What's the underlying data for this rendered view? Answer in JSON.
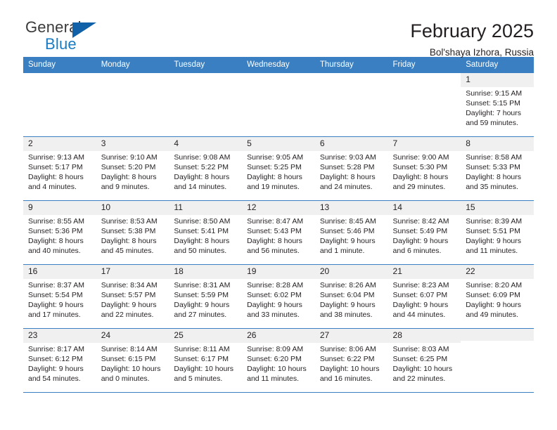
{
  "brand": {
    "name_top": "General",
    "name_bottom": "Blue",
    "triangle_icon": "triangle-icon",
    "color_primary": "#1161a8",
    "color_text": "#3b3b3b"
  },
  "header": {
    "title": "February 2025",
    "subtitle": "Bol'shaya Izhora, Russia"
  },
  "theme": {
    "header_blue": "#3a7fc1",
    "daynum_gray": "#f0f0f0",
    "text": "#231f20"
  },
  "calendar": {
    "weekdays": [
      "Sunday",
      "Monday",
      "Tuesday",
      "Wednesday",
      "Thursday",
      "Friday",
      "Saturday"
    ],
    "labels": {
      "sunrise": "Sunrise:",
      "sunset": "Sunset:",
      "daylight": "Daylight:"
    },
    "weeks": [
      [
        {
          "day": "",
          "blank": true
        },
        {
          "day": "",
          "blank": true
        },
        {
          "day": "",
          "blank": true
        },
        {
          "day": "",
          "blank": true
        },
        {
          "day": "",
          "blank": true
        },
        {
          "day": "",
          "blank": true
        },
        {
          "day": "1",
          "sunrise": "Sunrise: 9:15 AM",
          "sunset": "Sunset: 5:15 PM",
          "daylight1": "Daylight: 7 hours",
          "daylight2": "and 59 minutes."
        }
      ],
      [
        {
          "day": "2",
          "sunrise": "Sunrise: 9:13 AM",
          "sunset": "Sunset: 5:17 PM",
          "daylight1": "Daylight: 8 hours",
          "daylight2": "and 4 minutes."
        },
        {
          "day": "3",
          "sunrise": "Sunrise: 9:10 AM",
          "sunset": "Sunset: 5:20 PM",
          "daylight1": "Daylight: 8 hours",
          "daylight2": "and 9 minutes."
        },
        {
          "day": "4",
          "sunrise": "Sunrise: 9:08 AM",
          "sunset": "Sunset: 5:22 PM",
          "daylight1": "Daylight: 8 hours",
          "daylight2": "and 14 minutes."
        },
        {
          "day": "5",
          "sunrise": "Sunrise: 9:05 AM",
          "sunset": "Sunset: 5:25 PM",
          "daylight1": "Daylight: 8 hours",
          "daylight2": "and 19 minutes."
        },
        {
          "day": "6",
          "sunrise": "Sunrise: 9:03 AM",
          "sunset": "Sunset: 5:28 PM",
          "daylight1": "Daylight: 8 hours",
          "daylight2": "and 24 minutes."
        },
        {
          "day": "7",
          "sunrise": "Sunrise: 9:00 AM",
          "sunset": "Sunset: 5:30 PM",
          "daylight1": "Daylight: 8 hours",
          "daylight2": "and 29 minutes."
        },
        {
          "day": "8",
          "sunrise": "Sunrise: 8:58 AM",
          "sunset": "Sunset: 5:33 PM",
          "daylight1": "Daylight: 8 hours",
          "daylight2": "and 35 minutes."
        }
      ],
      [
        {
          "day": "9",
          "sunrise": "Sunrise: 8:55 AM",
          "sunset": "Sunset: 5:36 PM",
          "daylight1": "Daylight: 8 hours",
          "daylight2": "and 40 minutes."
        },
        {
          "day": "10",
          "sunrise": "Sunrise: 8:53 AM",
          "sunset": "Sunset: 5:38 PM",
          "daylight1": "Daylight: 8 hours",
          "daylight2": "and 45 minutes."
        },
        {
          "day": "11",
          "sunrise": "Sunrise: 8:50 AM",
          "sunset": "Sunset: 5:41 PM",
          "daylight1": "Daylight: 8 hours",
          "daylight2": "and 50 minutes."
        },
        {
          "day": "12",
          "sunrise": "Sunrise: 8:47 AM",
          "sunset": "Sunset: 5:43 PM",
          "daylight1": "Daylight: 8 hours",
          "daylight2": "and 56 minutes."
        },
        {
          "day": "13",
          "sunrise": "Sunrise: 8:45 AM",
          "sunset": "Sunset: 5:46 PM",
          "daylight1": "Daylight: 9 hours",
          "daylight2": "and 1 minute."
        },
        {
          "day": "14",
          "sunrise": "Sunrise: 8:42 AM",
          "sunset": "Sunset: 5:49 PM",
          "daylight1": "Daylight: 9 hours",
          "daylight2": "and 6 minutes."
        },
        {
          "day": "15",
          "sunrise": "Sunrise: 8:39 AM",
          "sunset": "Sunset: 5:51 PM",
          "daylight1": "Daylight: 9 hours",
          "daylight2": "and 11 minutes."
        }
      ],
      [
        {
          "day": "16",
          "sunrise": "Sunrise: 8:37 AM",
          "sunset": "Sunset: 5:54 PM",
          "daylight1": "Daylight: 9 hours",
          "daylight2": "and 17 minutes."
        },
        {
          "day": "17",
          "sunrise": "Sunrise: 8:34 AM",
          "sunset": "Sunset: 5:57 PM",
          "daylight1": "Daylight: 9 hours",
          "daylight2": "and 22 minutes."
        },
        {
          "day": "18",
          "sunrise": "Sunrise: 8:31 AM",
          "sunset": "Sunset: 5:59 PM",
          "daylight1": "Daylight: 9 hours",
          "daylight2": "and 27 minutes."
        },
        {
          "day": "19",
          "sunrise": "Sunrise: 8:28 AM",
          "sunset": "Sunset: 6:02 PM",
          "daylight1": "Daylight: 9 hours",
          "daylight2": "and 33 minutes."
        },
        {
          "day": "20",
          "sunrise": "Sunrise: 8:26 AM",
          "sunset": "Sunset: 6:04 PM",
          "daylight1": "Daylight: 9 hours",
          "daylight2": "and 38 minutes."
        },
        {
          "day": "21",
          "sunrise": "Sunrise: 8:23 AM",
          "sunset": "Sunset: 6:07 PM",
          "daylight1": "Daylight: 9 hours",
          "daylight2": "and 44 minutes."
        },
        {
          "day": "22",
          "sunrise": "Sunrise: 8:20 AM",
          "sunset": "Sunset: 6:09 PM",
          "daylight1": "Daylight: 9 hours",
          "daylight2": "and 49 minutes."
        }
      ],
      [
        {
          "day": "23",
          "sunrise": "Sunrise: 8:17 AM",
          "sunset": "Sunset: 6:12 PM",
          "daylight1": "Daylight: 9 hours",
          "daylight2": "and 54 minutes."
        },
        {
          "day": "24",
          "sunrise": "Sunrise: 8:14 AM",
          "sunset": "Sunset: 6:15 PM",
          "daylight1": "Daylight: 10 hours",
          "daylight2": "and 0 minutes."
        },
        {
          "day": "25",
          "sunrise": "Sunrise: 8:11 AM",
          "sunset": "Sunset: 6:17 PM",
          "daylight1": "Daylight: 10 hours",
          "daylight2": "and 5 minutes."
        },
        {
          "day": "26",
          "sunrise": "Sunrise: 8:09 AM",
          "sunset": "Sunset: 6:20 PM",
          "daylight1": "Daylight: 10 hours",
          "daylight2": "and 11 minutes."
        },
        {
          "day": "27",
          "sunrise": "Sunrise: 8:06 AM",
          "sunset": "Sunset: 6:22 PM",
          "daylight1": "Daylight: 10 hours",
          "daylight2": "and 16 minutes."
        },
        {
          "day": "28",
          "sunrise": "Sunrise: 8:03 AM",
          "sunset": "Sunset: 6:25 PM",
          "daylight1": "Daylight: 10 hours",
          "daylight2": "and 22 minutes."
        },
        {
          "day": "",
          "empty": true
        }
      ]
    ]
  }
}
